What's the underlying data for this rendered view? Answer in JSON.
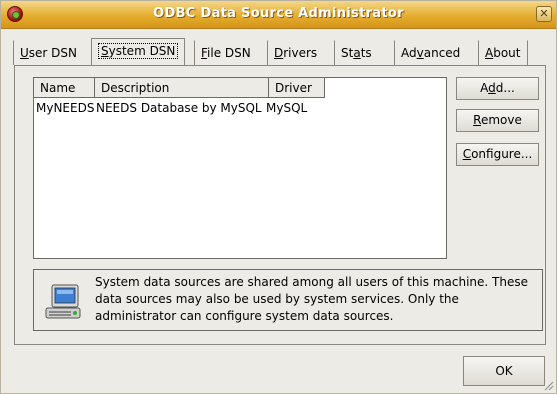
{
  "window": {
    "title": "ODBC Data Source Administrator",
    "close_glyph": "✕"
  },
  "tabs": [
    {
      "pre": "",
      "key": "U",
      "post": "ser DSN"
    },
    {
      "pre": "",
      "key": "S",
      "post": "ystem DSN"
    },
    {
      "pre": "",
      "key": "F",
      "post": "ile DSN"
    },
    {
      "pre": "",
      "key": "D",
      "post": "rivers"
    },
    {
      "pre": "St",
      "key": "a",
      "post": "ts"
    },
    {
      "pre": "Ad",
      "key": "v",
      "post": "anced"
    },
    {
      "pre": "",
      "key": "A",
      "post": "bout"
    }
  ],
  "list": {
    "columns": [
      "Name",
      "Description",
      "Driver"
    ],
    "rows": [
      {
        "name": "MyNEEDS",
        "description": "NEEDS Database by MySQL",
        "driver": "MySQL"
      }
    ]
  },
  "buttons": {
    "add": {
      "pre": "A",
      "key": "d",
      "post": "d..."
    },
    "remove": {
      "pre": "",
      "key": "R",
      "post": "emove"
    },
    "configure": {
      "pre": "",
      "key": "C",
      "post": "onfigure..."
    },
    "ok": "OK"
  },
  "info_text": "System data sources are shared among all users of this machine. These data sources may also be used by system services. Only the administrator can configure system data sources.",
  "colors": {
    "titlebar": "#e5ad2e",
    "window_bg": "#ecebe5"
  }
}
